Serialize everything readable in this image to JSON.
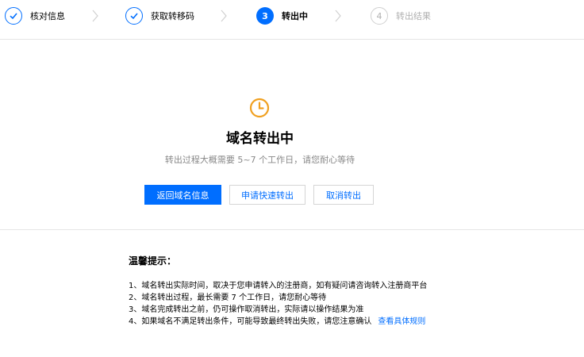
{
  "steps": [
    {
      "number": "1",
      "label": "核对信息",
      "state": "done"
    },
    {
      "number": "2",
      "label": "获取转移码",
      "state": "done"
    },
    {
      "number": "3",
      "label": "转出中",
      "state": "active"
    },
    {
      "number": "4",
      "label": "转出结果",
      "state": "pending"
    }
  ],
  "status": {
    "title": "域名转出中",
    "subtitle": "转出过程大概需要 5~7 个工作日，请您耐心等待"
  },
  "actions": {
    "back_label": "返回域名信息",
    "expedite_label": "申请快速转出",
    "cancel_label": "取消转出"
  },
  "tips": {
    "title": "温馨提示：",
    "items": [
      "1、域名转出实际时间，取决于您申请转入的注册商，如有疑问请咨询转入注册商平台",
      "2、域名转出过程，最长需要 7 个工作日，请您耐心等待",
      "3、域名完成转出之前，仍可操作取消转出，实际请以操作结果为准",
      "4、如果域名不满足转出条件，可能导致最终转出失败，请您注意确认"
    ],
    "rules_link": "查看具体规则"
  },
  "colors": {
    "accent": "#006eff",
    "warning": "#f0a020",
    "muted": "#888888"
  },
  "icons": {
    "done_step": "check-icon",
    "status": "clock-icon",
    "separator": "chevron-right-icon"
  }
}
